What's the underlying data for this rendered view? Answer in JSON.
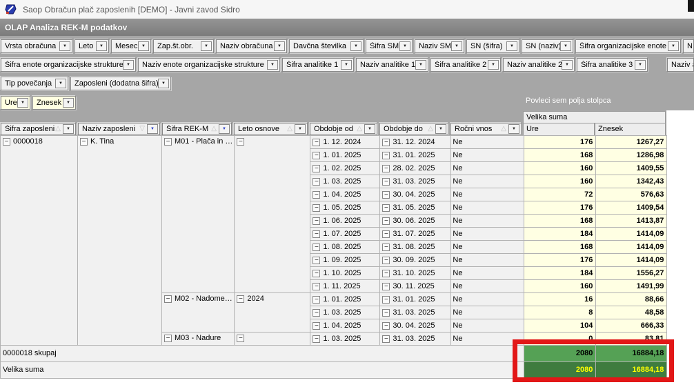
{
  "titlebar": {
    "title": "Saop Obračun plač zaposlenih [DEMO] - Javni zavod Sidro"
  },
  "olap_header": {
    "title": "OLAP Analiza REK-M podatkov"
  },
  "drop_zone": {
    "label": "Povleci sem polja stolpca"
  },
  "filter_fields_row1": [
    "Vrsta obračuna",
    "Leto",
    "Mesec",
    "Zap.št.obr.",
    "Naziv obračuna",
    "Davčna številka",
    "Šifra SM",
    "Naziv SM",
    "SN (šifra)",
    "SN (naziv)",
    "Šifra organizacijske enote",
    "N"
  ],
  "filter_fields_row2": [
    "Šifra enote organizacijske strukture",
    "Naziv enote organizacijske strukture",
    "Šifra analitike 1",
    "Naziv analitike 1",
    "Šifra analitike 2",
    "Naziv analitike 2",
    "Šifra analitike 3",
    "Naziv anal"
  ],
  "filter_fields_row3": [
    "Tip povečanja",
    "Zaposleni (dodatna šifra)"
  ],
  "data_fields": [
    "Ure",
    "Znesek"
  ],
  "column_area": {
    "grand_header": "Velika suma",
    "value_columns": [
      "Ure",
      "Znesek"
    ]
  },
  "row_fields": [
    {
      "label": "Šifra zaposleni",
      "sort": "asc",
      "filter_active": false
    },
    {
      "label": "Naziv zaposleni",
      "sort": "desc",
      "filter_active": true
    },
    {
      "label": "Šifra REK-M",
      "sort": "asc",
      "filter_active": true
    },
    {
      "label": "Leto osnove",
      "sort": "asc",
      "filter_active": false
    },
    {
      "label": "Obdobje od",
      "sort": "asc",
      "filter_active": false
    },
    {
      "label": "Obdobje do",
      "sort": "asc",
      "filter_active": false
    },
    {
      "label": "Ročni vnos",
      "sort": "asc",
      "filter_active": false
    }
  ],
  "pivot": {
    "employee": {
      "code": "0000018",
      "name": "K. Tina"
    },
    "groups": [
      {
        "rek": "M01 - Plača in …",
        "leto_osnove": "",
        "rows": [
          {
            "od": "1. 12. 2024",
            "do": "31. 12. 2024",
            "rocni": "Ne",
            "ure": "176",
            "znesek": "1267,27"
          },
          {
            "od": "1. 01. 2025",
            "do": "31. 01. 2025",
            "rocni": "Ne",
            "ure": "168",
            "znesek": "1286,98"
          },
          {
            "od": "1. 02. 2025",
            "do": "28. 02. 2025",
            "rocni": "Ne",
            "ure": "160",
            "znesek": "1409,55"
          },
          {
            "od": "1. 03. 2025",
            "do": "31. 03. 2025",
            "rocni": "Ne",
            "ure": "160",
            "znesek": "1342,43"
          },
          {
            "od": "1. 04. 2025",
            "do": "30. 04. 2025",
            "rocni": "Ne",
            "ure": "72",
            "znesek": "576,63"
          },
          {
            "od": "1. 05. 2025",
            "do": "31. 05. 2025",
            "rocni": "Ne",
            "ure": "176",
            "znesek": "1409,54"
          },
          {
            "od": "1. 06. 2025",
            "do": "30. 06. 2025",
            "rocni": "Ne",
            "ure": "168",
            "znesek": "1413,87"
          },
          {
            "od": "1. 07. 2025",
            "do": "31. 07. 2025",
            "rocni": "Ne",
            "ure": "184",
            "znesek": "1414,09"
          },
          {
            "od": "1. 08. 2025",
            "do": "31. 08. 2025",
            "rocni": "Ne",
            "ure": "168",
            "znesek": "1414,09"
          },
          {
            "od": "1. 09. 2025",
            "do": "30. 09. 2025",
            "rocni": "Ne",
            "ure": "176",
            "znesek": "1414,09"
          },
          {
            "od": "1. 10. 2025",
            "do": "31. 10. 2025",
            "rocni": "Ne",
            "ure": "184",
            "znesek": "1556,27"
          },
          {
            "od": "1. 11. 2025",
            "do": "30. 11. 2025",
            "rocni": "Ne",
            "ure": "160",
            "znesek": "1491,99"
          }
        ]
      },
      {
        "rek": "M02 - Nadome…",
        "leto_osnove": "2024",
        "rows": [
          {
            "od": "1. 01. 2025",
            "do": "31. 01. 2025",
            "rocni": "Ne",
            "ure": "16",
            "znesek": "88,66"
          },
          {
            "od": "1. 03. 2025",
            "do": "31. 03. 2025",
            "rocni": "Ne",
            "ure": "8",
            "znesek": "48,58"
          },
          {
            "od": "1. 04. 2025",
            "do": "30. 04. 2025",
            "rocni": "Ne",
            "ure": "104",
            "znesek": "666,33"
          }
        ]
      },
      {
        "rek": "M03 - Nadure",
        "leto_osnove": "",
        "rows": [
          {
            "od": "1. 03. 2025",
            "do": "31. 03. 2025",
            "rocni": "Ne",
            "ure": "0",
            "znesek": "83,81"
          }
        ]
      }
    ],
    "subtotal": {
      "label": "0000018 skupaj",
      "ure": "2080",
      "znesek": "16884,18"
    },
    "grand_total": {
      "label": "Velika suma",
      "ure": "2080",
      "znesek": "16884,18"
    }
  },
  "icons": {
    "collapse": "−",
    "dropdown": "▼",
    "sort_asc": "△",
    "sort_desc": "▽"
  },
  "colors": {
    "value_cell_bg": "#ffffe3",
    "subtotal_green": "#55a155",
    "grand_green": "#3f7c3f",
    "grand_text": "#ffff00",
    "annotation_red": "#e21717"
  }
}
